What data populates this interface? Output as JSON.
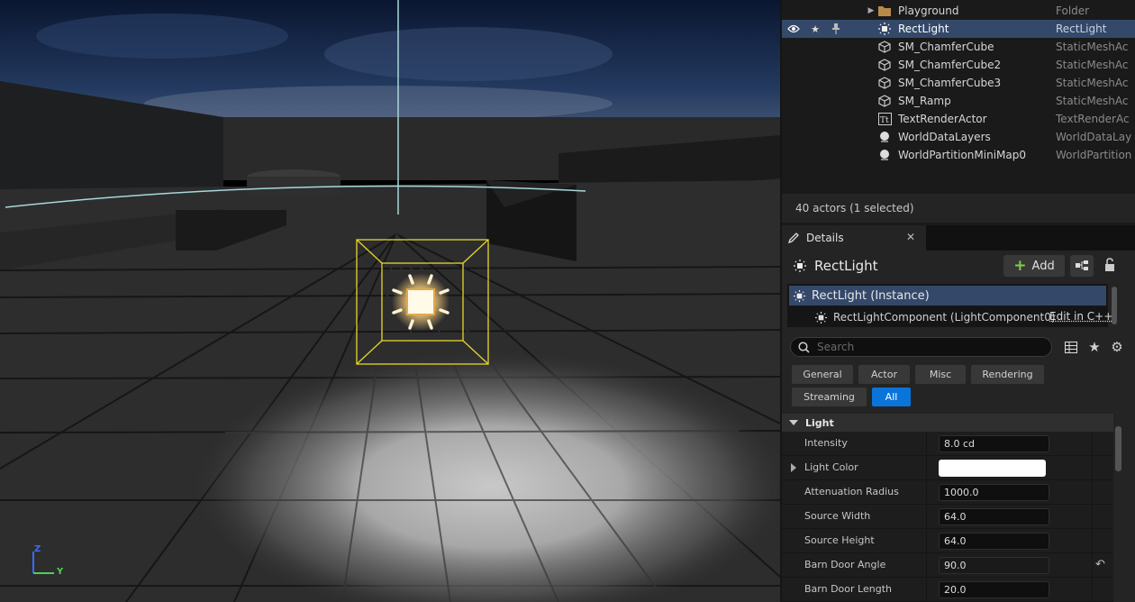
{
  "outliner": {
    "rows": [
      {
        "name": "Playground",
        "type": "Folder",
        "icon": "folder-icon"
      },
      {
        "name": "RectLight",
        "type": "RectLight",
        "icon": "rect-light-icon",
        "selected": true
      },
      {
        "name": "SM_ChamferCube",
        "type": "StaticMeshAc",
        "icon": "static-mesh-icon"
      },
      {
        "name": "SM_ChamferCube2",
        "type": "StaticMeshAc",
        "icon": "static-mesh-icon"
      },
      {
        "name": "SM_ChamferCube3",
        "type": "StaticMeshAc",
        "icon": "static-mesh-icon"
      },
      {
        "name": "SM_Ramp",
        "type": "StaticMeshAc",
        "icon": "static-mesh-icon"
      },
      {
        "name": "TextRenderActor",
        "type": "TextRenderAc",
        "icon": "text-render-icon"
      },
      {
        "name": "WorldDataLayers",
        "type": "WorldDataLay",
        "icon": "world-data-layers-icon"
      },
      {
        "name": "WorldPartitionMiniMap0",
        "type": "WorldPartition",
        "icon": "world-partition-icon"
      }
    ],
    "actor_count": "40 actors (1 selected)"
  },
  "details": {
    "tab_label": "Details",
    "title": "RectLight",
    "add_label": "Add",
    "instance_label": "RectLight (Instance)",
    "component_label": "RectLightComponent (LightComponent0)",
    "edit_cpp_label": "Edit in C++",
    "search_placeholder": "Search",
    "filter_tabs": [
      "General",
      "Actor",
      "Misc",
      "Rendering",
      "Streaming",
      "All"
    ],
    "active_filter": "All",
    "section_title": "Light",
    "properties": [
      {
        "label": "Intensity",
        "value": "8.0 cd"
      },
      {
        "label": "Light Color",
        "value": "",
        "color": "#ffffff"
      },
      {
        "label": "Attenuation Radius",
        "value": "1000.0"
      },
      {
        "label": "Source Width",
        "value": "64.0"
      },
      {
        "label": "Source Height",
        "value": "64.0"
      },
      {
        "label": "Barn Door Angle",
        "value": "90.0"
      },
      {
        "label": "Barn Door Length",
        "value": "20.0"
      }
    ]
  },
  "viewport": {
    "gizmo_labels": {
      "z": "Z",
      "y": "Y"
    }
  },
  "colors": {
    "selection": "#34496a",
    "accent_blue": "#0a74d9",
    "light_bounds": "#e6d72a",
    "add_plus": "#7bd04a"
  }
}
